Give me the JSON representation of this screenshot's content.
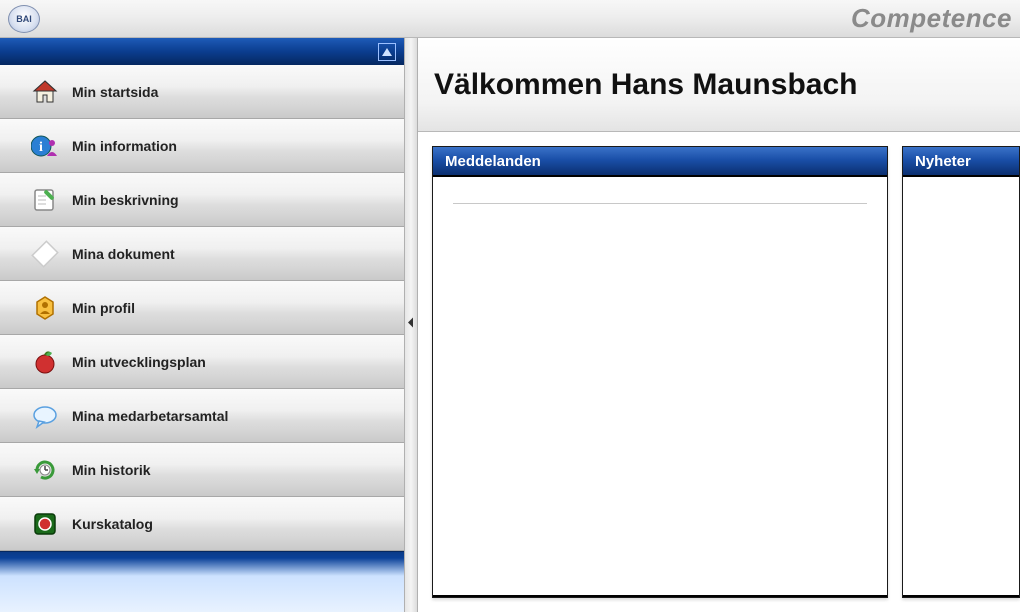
{
  "app": {
    "logo_text": "BAI",
    "brand": "Competence"
  },
  "sidebar": {
    "items": [
      {
        "label": "Min startsida",
        "icon": "home-icon"
      },
      {
        "label": "Min information",
        "icon": "info-person-icon"
      },
      {
        "label": "Min beskrivning",
        "icon": "edit-note-icon"
      },
      {
        "label": "Mina dokument",
        "icon": "document-icon"
      },
      {
        "label": "Min profil",
        "icon": "profile-badge-icon"
      },
      {
        "label": "Min utvecklingsplan",
        "icon": "apple-plan-icon"
      },
      {
        "label": "Mina medarbetarsamtal",
        "icon": "chat-bubble-icon"
      },
      {
        "label": "Min historik",
        "icon": "history-icon"
      },
      {
        "label": "Kurskatalog",
        "icon": "catalog-icon"
      }
    ]
  },
  "main": {
    "title": "Välkommen Hans Maunsbach",
    "panels": {
      "messages_title": "Meddelanden",
      "news_title": "Nyheter"
    }
  }
}
